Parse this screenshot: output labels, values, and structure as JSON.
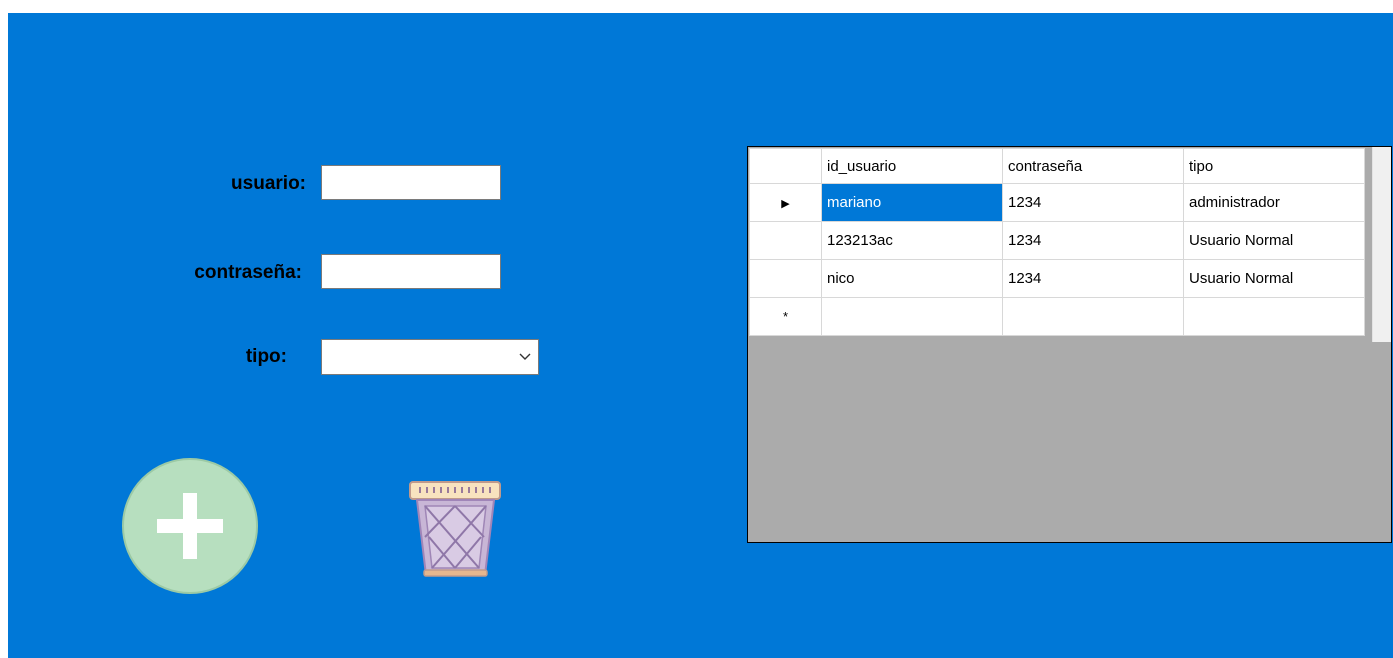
{
  "form": {
    "usuario_label": "usuario:",
    "usuario_value": "",
    "contrasena_label": "contraseña:",
    "contrasena_value": "",
    "tipo_label": "tipo:",
    "tipo_value": ""
  },
  "actions": {
    "add_icon": "plus-circle-icon",
    "delete_icon": "trash-can-icon"
  },
  "grid": {
    "columns": [
      "id_usuario",
      "contraseña",
      "tipo"
    ],
    "rows": [
      [
        "mariano",
        "1234",
        "administrador"
      ],
      [
        "123213ac",
        "1234",
        "Usuario Normal"
      ],
      [
        "nico",
        "1234",
        "Usuario Normal"
      ]
    ],
    "current_row_marker": "▶",
    "new_row_marker": "*"
  },
  "colors": {
    "panel_background": "#0078d7",
    "grid_background": "#ababab",
    "selection": "#0078d7",
    "add_button": "#b7dfbf"
  }
}
